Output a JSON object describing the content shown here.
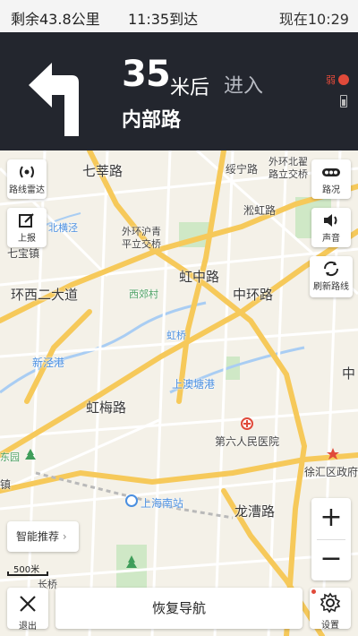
{
  "status": {
    "remaining": "剩余43.8公里",
    "eta": "11:35到达",
    "now": "现在10:29"
  },
  "guidance": {
    "turn_icon": "turn-left-arrow-icon",
    "distance": "35",
    "unit": "米后",
    "action": "进入",
    "road": "内部路",
    "gps": "弱"
  },
  "map_buttons": {
    "radar": "路线雷达",
    "report": "上报",
    "traffic": "路况",
    "voice": "声音",
    "refresh": "刷新路线",
    "smart": "智能推荐",
    "scale": "500米",
    "zoom_in": "+",
    "zoom_out": "−"
  },
  "bottom": {
    "exit": "退出",
    "resume": "恢复导航",
    "settings": "设置"
  },
  "map_labels": {
    "qixin": "七莘路",
    "wuning": "绥宁路",
    "outer_north_1": "外环北翟",
    "outer_north_2": "路立交桥",
    "beiheng": "北横泾",
    "outer_hu_1": "外环沪青",
    "outer_hu_2": "平立交桥",
    "songhong": "淞虹路",
    "qibao": "七宝镇",
    "huanxi": "环西二大道",
    "xijiao": "西郊村",
    "zhonghuan_1": "虹中路",
    "zhonghuan_2": "中环路",
    "xinjing": "新泾港",
    "hongqiao": "虹桥",
    "shangao": "上澳塘港",
    "zhong": "中",
    "hongmei": "虹梅路",
    "hospital": "第六人民医院",
    "xuhui": "徐汇区政府",
    "dongyuan": "东园",
    "jizhen": "镇",
    "shanghai_south": "上海南站",
    "longcao": "龙漕路",
    "changqiao": "长桥"
  }
}
